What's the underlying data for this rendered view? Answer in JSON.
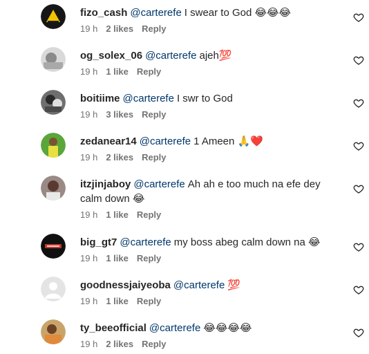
{
  "comments": [
    {
      "username": "fizo_cash",
      "mention": "@carterefe",
      "text": "I swear to God",
      "emoji": "😂😂😂",
      "time": "19 h",
      "likes": "2 likes",
      "reply": "Reply",
      "avatar_color": "#1a1a1a"
    },
    {
      "username": "og_solex_06",
      "mention": "@carterefe",
      "text": "ajeh",
      "emoji": "💯",
      "time": "19 h",
      "likes": "1 like",
      "reply": "Reply",
      "avatar_color": "#cfcfcf"
    },
    {
      "username": "boitiime",
      "mention": "@carterefe",
      "text": "I swr to God",
      "emoji": "",
      "time": "19 h",
      "likes": "3 likes",
      "reply": "Reply",
      "avatar_color": "#3a3a3a"
    },
    {
      "username": "zedanear14",
      "mention": "@carterefe",
      "text": "1 Ameen",
      "emoji": "🙏❤️",
      "time": "19 h",
      "likes": "2 likes",
      "reply": "Reply",
      "avatar_color": "#d8d04a"
    },
    {
      "username": "itzjinjaboy",
      "mention": "@carterefe",
      "text": "Ah ah e too much na efe dey calm down",
      "emoji": "😂",
      "time": "19 h",
      "likes": "1 like",
      "reply": "Reply",
      "avatar_color": "#6a4b44"
    },
    {
      "username": "big_gt7",
      "mention": "@carterefe",
      "text": "my boss abeg calm down na",
      "emoji": "😂",
      "time": "19 h",
      "likes": "1 like",
      "reply": "Reply",
      "avatar_color": "#111111"
    },
    {
      "username": "goodnessjaiyeoba",
      "mention": "@carterefe",
      "text": "",
      "emoji": "💯",
      "time": "19 h",
      "likes": "1 like",
      "reply": "Reply",
      "avatar_color": "#e3e3e3"
    },
    {
      "username": "ty_beeofficial",
      "mention": "@carterefe",
      "text": "",
      "emoji": "😂😂😂😂",
      "time": "19 h",
      "likes": "2 likes",
      "reply": "Reply",
      "avatar_color": "#b08a5c"
    }
  ]
}
